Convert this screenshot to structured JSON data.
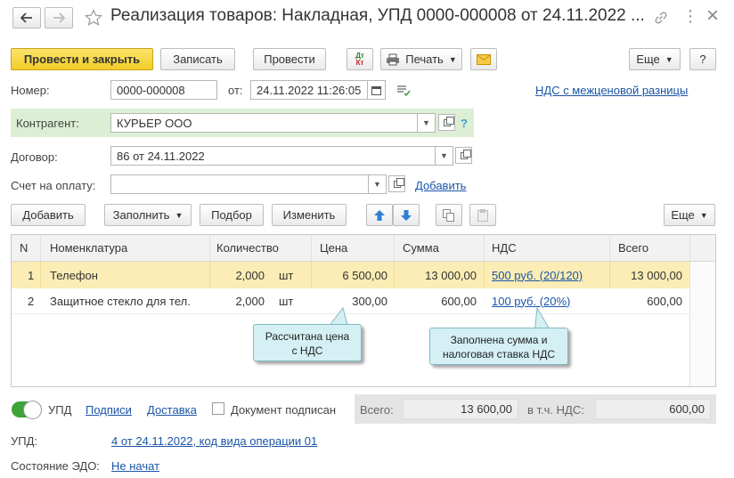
{
  "header": {
    "title": "Реализация товаров: Накладная, УПД 0000-000008 от 24.11.2022 ...",
    "more_glyph": "⋮",
    "close_glyph": "×"
  },
  "toolbar": {
    "post_close": "Провести и закрыть",
    "save": "Записать",
    "post": "Провести",
    "dtkt_top": "Дт",
    "dtkt_bottom": "Кт",
    "print": "Печать",
    "more": "Еще",
    "help": "?"
  },
  "form": {
    "number_label": "Номер:",
    "number_value": "0000-000008",
    "date_label": "от:",
    "date_value": "24.11.2022 11:26:05",
    "vat_diff_link": "НДС с межценовой разницы",
    "counterparty_label": "Контрагент:",
    "counterparty_value": "КУРЬЕР ООО",
    "help_q": "?",
    "contract_label": "Договор:",
    "contract_value": "86 от 24.11.2022",
    "invoice_label": "Счет на оплату:",
    "invoice_value": "",
    "invoice_add_link": "Добавить"
  },
  "table_toolbar": {
    "add": "Добавить",
    "fill": "Заполнить",
    "pick": "Подбор",
    "change": "Изменить",
    "more": "Еще"
  },
  "table": {
    "columns": [
      "N",
      "Номенклатура",
      "Количество",
      "Цена",
      "Сумма",
      "НДС",
      "Всего"
    ],
    "rows": [
      {
        "n": "1",
        "name": "Телефон",
        "qty": "2,000",
        "unit": "шт",
        "price": "6 500,00",
        "sum": "13 000,00",
        "vat": "500 руб. (20/120)",
        "total": "13 000,00"
      },
      {
        "n": "2",
        "name": "Защитное стекло для тел.",
        "qty": "2,000",
        "unit": "шт",
        "price": "300,00",
        "sum": "600,00",
        "vat": "100 руб. (20%)",
        "total": "600,00"
      }
    ]
  },
  "callouts": {
    "price_line1": "Рассчитана цена",
    "price_line2": "с НДС",
    "vat_line1": "Заполнена сумма и",
    "vat_line2": "налоговая ставка НДС"
  },
  "footer": {
    "upd_toggle_label": "УПД",
    "signatures_link": "Подписи",
    "delivery_link": "Доставка",
    "signed_label": "Документ подписан",
    "total_label": "Всего:",
    "total_value": "13 600,00",
    "vat_label": "в т.ч. НДС:",
    "vat_value": "600,00",
    "upd_label": "УПД:",
    "upd_link": "4 от 24.11.2022, код вида операции 01",
    "edo_label": "Состояние ЭДО:",
    "edo_link": "Не начат"
  },
  "colors": {
    "primary_button": "#f2cd28",
    "selected_row": "#fbedb5",
    "counterparty_bg": "#dcefd4",
    "link": "#1a55a8",
    "callout_bg": "#d5f0f4",
    "toggle_on": "#3da33a"
  }
}
